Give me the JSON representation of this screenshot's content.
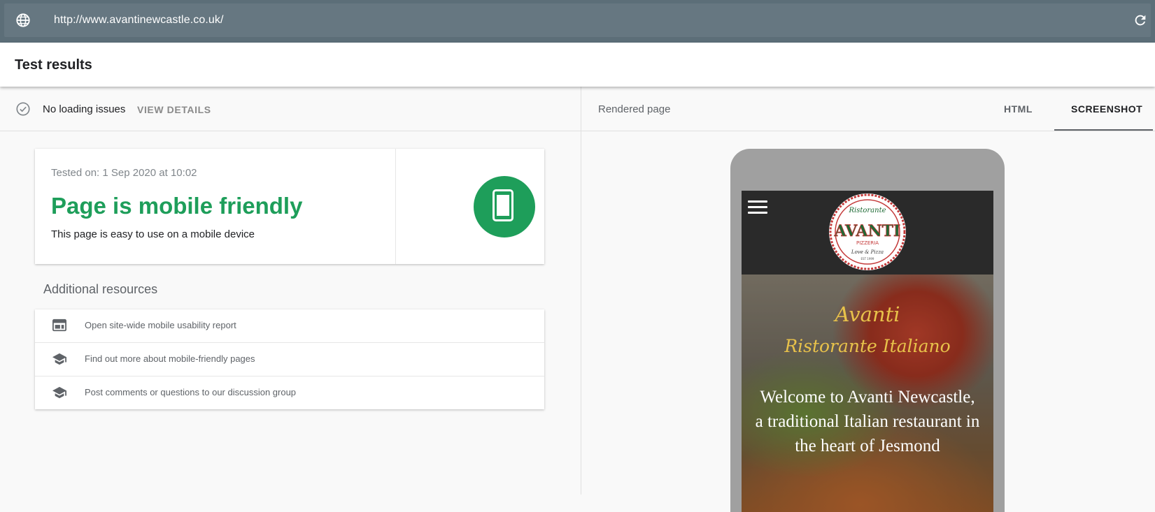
{
  "urlbar": {
    "url": "http://www.avantinewcastle.co.uk/",
    "globe_icon": "globe-icon",
    "refresh_icon": "refresh-icon"
  },
  "header": {
    "title": "Test results"
  },
  "status": {
    "text": "No loading issues",
    "action": "VIEW DETAILS",
    "icon": "check-circle-icon"
  },
  "result": {
    "tested_on": "Tested on: 1 Sep 2020 at 10:02",
    "title": "Page is mobile friendly",
    "subtitle": "This page is easy to use on a mobile device",
    "icon": "smartphone-icon",
    "accent": "#1e9e5a"
  },
  "resources": {
    "title": "Additional resources",
    "items": [
      {
        "label": "Open site-wide mobile usability report",
        "icon": "web-report-icon"
      },
      {
        "label": "Find out more about mobile-friendly pages",
        "icon": "school-icon"
      },
      {
        "label": "Post comments or questions to our discussion group",
        "icon": "school-icon"
      }
    ]
  },
  "rendered": {
    "label": "Rendered page",
    "tabs": [
      {
        "label": "HTML",
        "active": false
      },
      {
        "label": "SCREENSHOT",
        "active": true
      }
    ]
  },
  "site": {
    "logo_top": "Ristorante",
    "logo_name": "AVANTI",
    "logo_sub": "PIZZERIA",
    "logo_tagline": "Love & Pizza",
    "logo_est": "EST 1999",
    "hero_line1": "Avanti",
    "hero_line2": "Ristorante Italiano",
    "welcome": "Welcome to Avanti Newcastle, a traditional Italian restaurant in the heart of Jesmond"
  }
}
